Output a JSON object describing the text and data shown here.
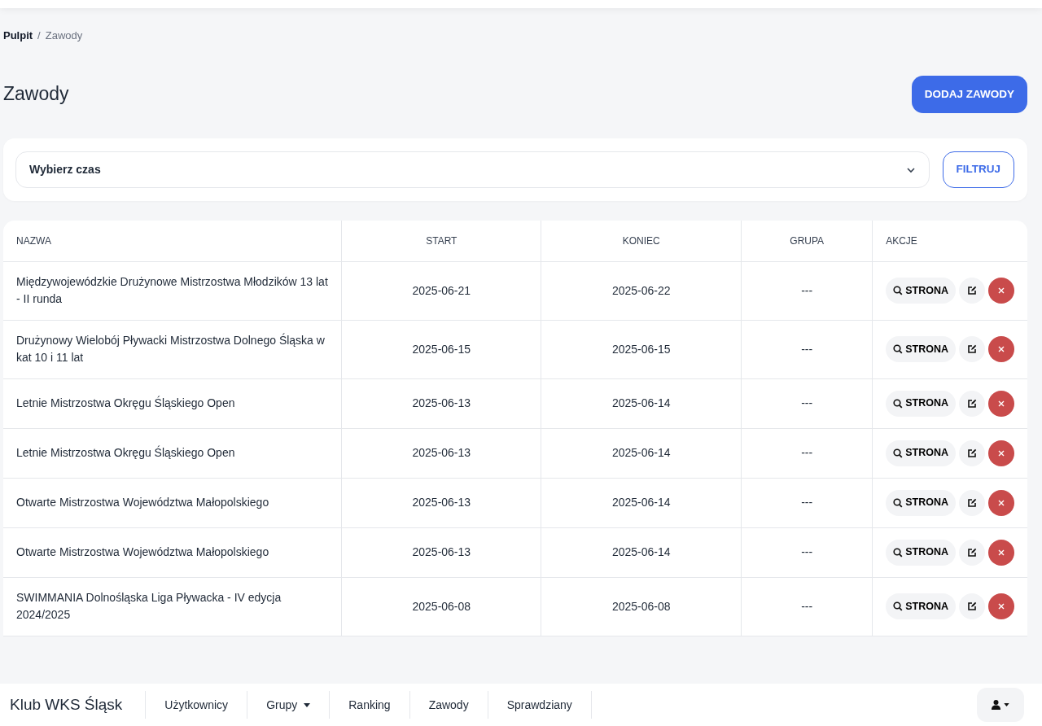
{
  "breadcrumb": [
    {
      "label": "Pulpit",
      "active": false
    },
    {
      "label": "Zawody",
      "active": true
    }
  ],
  "breadcrumb_separator": "/",
  "title": "Zawody",
  "add_button": "DODAJ ZAWODY",
  "filter": {
    "select_value": "Wybierz czas",
    "button": "FILTRUJ"
  },
  "table": {
    "columns": [
      "NAZWA",
      "START",
      "KONIEC",
      "GRUPA",
      "AKCJE"
    ],
    "rows": [
      {
        "name": "Międzywojewódzkie Drużynowe Mistrzostwa Młodzików 13 lat - II runda",
        "start": "2025-06-21",
        "end": "2025-06-22",
        "group": "---",
        "page_button": "STRONA"
      },
      {
        "name": "Drużynowy Wielobój Pływacki Mistrzostwa Dolnego Śląska w kat 10 i 11 lat",
        "start": "2025-06-15",
        "end": "2025-06-15",
        "group": "---",
        "page_button": "STRONA"
      },
      {
        "name": "Letnie Mistrzostwa Okręgu Śląskiego Open",
        "start": "2025-06-13",
        "end": "2025-06-14",
        "group": "---",
        "page_button": "STRONA"
      },
      {
        "name": "Letnie Mistrzostwa Okręgu Śląskiego Open",
        "start": "2025-06-13",
        "end": "2025-06-14",
        "group": "---",
        "page_button": "STRONA"
      },
      {
        "name": "Otwarte Mistrzostwa Województwa Małopolskiego",
        "start": "2025-06-13",
        "end": "2025-06-14",
        "group": "---",
        "page_button": "STRONA"
      },
      {
        "name": "Otwarte Mistrzostwa Województwa Małopolskiego",
        "start": "2025-06-13",
        "end": "2025-06-14",
        "group": "---",
        "page_button": "STRONA"
      },
      {
        "name": "SWIMMANIA Dolnośląska Liga Pływacka - IV edycja 2024/2025",
        "start": "2025-06-08",
        "end": "2025-06-08",
        "group": "---",
        "page_button": "STRONA"
      }
    ]
  },
  "navbar": {
    "brand": "Klub WKS Śląsk",
    "items": [
      {
        "label": "Użytkownicy",
        "dropdown": false
      },
      {
        "label": "Grupy",
        "dropdown": true
      },
      {
        "label": "Ranking",
        "dropdown": false
      },
      {
        "label": "Zawody",
        "dropdown": false
      },
      {
        "label": "Sprawdziany",
        "dropdown": false
      }
    ]
  }
}
